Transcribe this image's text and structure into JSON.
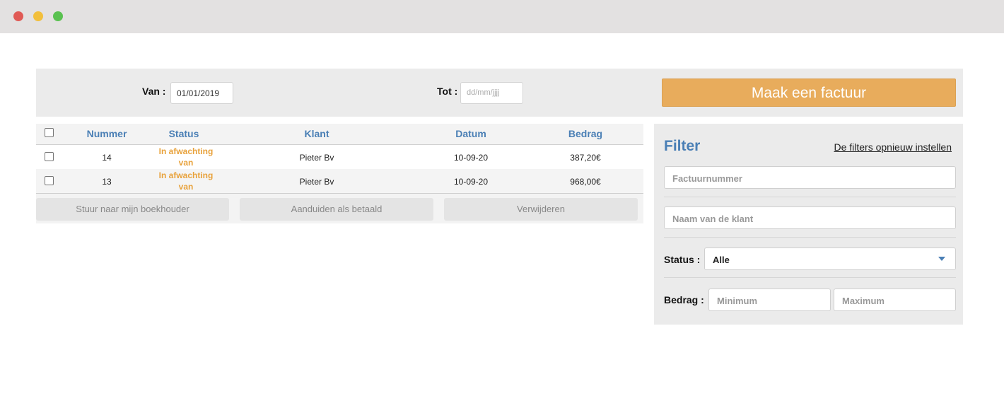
{
  "window": {
    "controls": [
      "close",
      "minimize",
      "maximize"
    ]
  },
  "topbar": {
    "from_label": "Van :",
    "from_value": "01/01/2019",
    "to_label": "Tot :",
    "to_placeholder": "dd/mm/jjjj",
    "create_button": "Maak een factuur"
  },
  "table": {
    "headers": {
      "number": "Nummer",
      "status": "Status",
      "client": "Klant",
      "date": "Datum",
      "amount": "Bedrag"
    },
    "rows": [
      {
        "number": "14",
        "status_line1": "In afwachting",
        "status_line2": "van",
        "client": "Pieter Bv",
        "date": "10-09-20",
        "amount": "387,20€"
      },
      {
        "number": "13",
        "status_line1": "In afwachting",
        "status_line2": "van",
        "client": "Pieter Bv",
        "date": "10-09-20",
        "amount": "968,00€"
      }
    ],
    "actions": {
      "send_accountant": "Stuur naar mijn boekhouder",
      "mark_paid": "Aanduiden als betaald",
      "delete": "Verwijderen"
    }
  },
  "filter": {
    "title": "Filter",
    "reset_link": "De filters opnieuw instellen",
    "invoice_number_placeholder": "Factuurnummer",
    "client_name_placeholder": "Naam van de klant",
    "status_label": "Status :",
    "status_value": "Alle",
    "amount_label": "Bedrag :",
    "min_placeholder": "Minimum",
    "max_placeholder": "Maximum"
  },
  "colors": {
    "accent": "#4a7fb5",
    "primary_button": "#e8ac5c",
    "status_pending": "#e8a23c"
  }
}
